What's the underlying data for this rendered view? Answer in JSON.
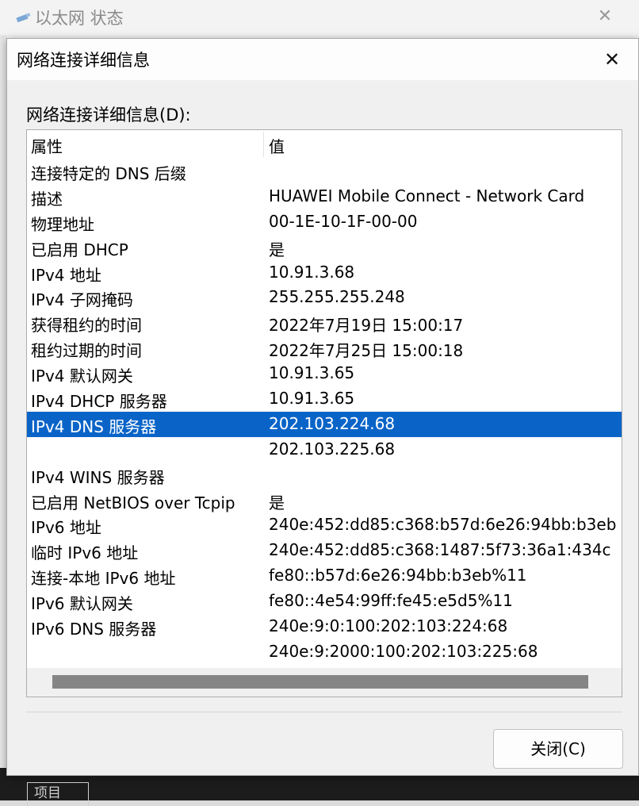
{
  "background_window": {
    "title": "以太网 状态",
    "close_label": "✕",
    "bottom_tab_label": "项目"
  },
  "dialog": {
    "title": "网络连接详细信息",
    "close_label": "✕",
    "section_label": "网络连接详细信息(D):",
    "columns": [
      "属性",
      "值"
    ],
    "rows": [
      {
        "property": "连接特定的 DNS 后缀",
        "value": ""
      },
      {
        "property": "描述",
        "value": "HUAWEI Mobile Connect - Network Card"
      },
      {
        "property": "物理地址",
        "value": "00-1E-10-1F-00-00"
      },
      {
        "property": "已启用 DHCP",
        "value": "是"
      },
      {
        "property": "IPv4 地址",
        "value": "10.91.3.68"
      },
      {
        "property": "IPv4 子网掩码",
        "value": "255.255.255.248"
      },
      {
        "property": "获得租约的时间",
        "value": "2022年7月19日 15:00:17"
      },
      {
        "property": "租约过期的时间",
        "value": "2022年7月25日 15:00:18"
      },
      {
        "property": "IPv4 默认网关",
        "value": "10.91.3.65"
      },
      {
        "property": "IPv4 DHCP 服务器",
        "value": "10.91.3.65"
      },
      {
        "property": "IPv4 DNS 服务器",
        "value": "202.103.224.68"
      },
      {
        "property": "",
        "value": "202.103.225.68"
      },
      {
        "property": "IPv4 WINS 服务器",
        "value": ""
      },
      {
        "property": "已启用 NetBIOS over Tcpip",
        "value": "是"
      },
      {
        "property": "IPv6 地址",
        "value": "240e:452:dd85:c368:b57d:6e26:94bb:b3eb"
      },
      {
        "property": "临时 IPv6 地址",
        "value": "240e:452:dd85:c368:1487:5f73:36a1:434c"
      },
      {
        "property": "连接-本地 IPv6 地址",
        "value": "fe80::b57d:6e26:94bb:b3eb%11"
      },
      {
        "property": "IPv6 默认网关",
        "value": "fe80::4e54:99ff:fe45:e5d5%11"
      },
      {
        "property": "IPv6 DNS 服务器",
        "value": "240e:9:0:100:202:103:224:68"
      },
      {
        "property": "",
        "value": "240e:9:2000:100:202:103:225:68"
      }
    ],
    "selected_row_index": 10,
    "close_button_label": "关闭(C)"
  },
  "colors": {
    "selection": "#0a64c8",
    "dialog_bg": "#f0f0f0",
    "list_bg": "#ffffff"
  },
  "icons": {
    "background_window_icon": "ethernet-icon",
    "close": "close-icon"
  }
}
